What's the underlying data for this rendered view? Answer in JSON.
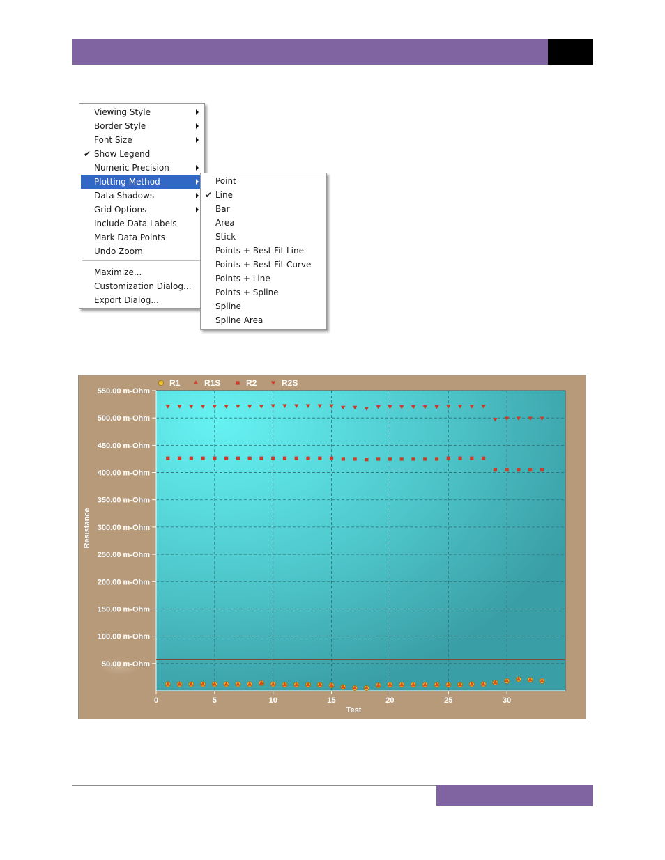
{
  "menu": {
    "items": [
      {
        "label": "Viewing Style",
        "submenu": true,
        "checked": false
      },
      {
        "label": "Border Style",
        "submenu": true,
        "checked": false
      },
      {
        "label": "Font Size",
        "submenu": true,
        "checked": false
      },
      {
        "label": "Show Legend",
        "submenu": false,
        "checked": true
      },
      {
        "label": "Numeric Precision",
        "submenu": true,
        "checked": false
      },
      {
        "label": "Plotting Method",
        "submenu": true,
        "checked": false,
        "highlighted": true
      },
      {
        "label": "Data Shadows",
        "submenu": true,
        "checked": false
      },
      {
        "label": "Grid Options",
        "submenu": true,
        "checked": false
      },
      {
        "label": "Include Data Labels",
        "submenu": false,
        "checked": false
      },
      {
        "label": "Mark Data Points",
        "submenu": false,
        "checked": false
      },
      {
        "label": "Undo Zoom",
        "submenu": false,
        "checked": false
      }
    ],
    "items2": [
      {
        "label": "Maximize..."
      },
      {
        "label": "Customization Dialog..."
      },
      {
        "label": "Export Dialog..."
      }
    ],
    "submenu": [
      {
        "label": "Point",
        "checked": false
      },
      {
        "label": "Line",
        "checked": true
      },
      {
        "label": "Bar",
        "checked": false
      },
      {
        "label": "Area",
        "checked": false
      },
      {
        "label": "Stick",
        "checked": false
      },
      {
        "label": "Points + Best Fit Line",
        "checked": false
      },
      {
        "label": "Points + Best Fit Curve",
        "checked": false
      },
      {
        "label": "Points + Line",
        "checked": false
      },
      {
        "label": "Points + Spline",
        "checked": false
      },
      {
        "label": "Spline",
        "checked": false
      },
      {
        "label": "Spline Area",
        "checked": false
      }
    ]
  },
  "chart_data": {
    "type": "scatter",
    "xlabel": "Test",
    "ylabel": "Resistance",
    "xlim": [
      0,
      35
    ],
    "ylim": [
      0,
      550
    ],
    "x_ticks": [
      "0",
      "5",
      "10",
      "15",
      "20",
      "25",
      "30"
    ],
    "x_tick_values": [
      0,
      5,
      10,
      15,
      20,
      25,
      30
    ],
    "y_ticks": [
      "50.00 m-Ohm",
      "100.00 m-Ohm",
      "150.00 m-Ohm",
      "200.00 m-Ohm",
      "250.00 m-Ohm",
      "300.00 m-Ohm",
      "350.00 m-Ohm",
      "400.00 m-Ohm",
      "450.00 m-Ohm",
      "500.00 m-Ohm",
      "550.00 m-Ohm"
    ],
    "y_tick_values": [
      50,
      100,
      150,
      200,
      250,
      300,
      350,
      400,
      450,
      500,
      550
    ],
    "grid": true,
    "legend_position": "top",
    "reference_line": 57,
    "colors": {
      "R1": "#e0b020",
      "R1S": "#cc3a2a",
      "R2": "#cc3a2a",
      "R2S": "#cc3a2a"
    },
    "x": [
      1,
      2,
      3,
      4,
      5,
      6,
      7,
      8,
      9,
      10,
      11,
      12,
      13,
      14,
      15,
      16,
      17,
      18,
      19,
      20,
      21,
      22,
      23,
      24,
      25,
      26,
      27,
      28,
      29,
      30,
      31,
      32,
      33
    ],
    "series": [
      {
        "name": "R1",
        "marker": "circle",
        "values": [
          12,
          12,
          12,
          12,
          12,
          12,
          12,
          12,
          14,
          12,
          11,
          11,
          11,
          11,
          10,
          7,
          5,
          5,
          10,
          11,
          11,
          11,
          11,
          11,
          11,
          11,
          12,
          12,
          15,
          18,
          21,
          20,
          18
        ]
      },
      {
        "name": "R1S",
        "marker": "triangle-up",
        "values": [
          12,
          12,
          12,
          12,
          12,
          12,
          12,
          12,
          14,
          12,
          11,
          11,
          11,
          11,
          10,
          7,
          5,
          5,
          10,
          11,
          11,
          11,
          11,
          11,
          11,
          11,
          12,
          12,
          15,
          18,
          21,
          20,
          18
        ]
      },
      {
        "name": "R2",
        "marker": "square",
        "values": [
          426,
          426,
          426,
          426,
          426,
          426,
          426,
          426,
          426,
          426,
          426,
          426,
          426,
          426,
          426,
          425,
          425,
          424,
          425,
          425,
          425,
          425,
          425,
          425,
          426,
          426,
          426,
          426,
          405,
          405,
          405,
          405,
          405
        ]
      },
      {
        "name": "R2S",
        "marker": "triangle-down",
        "values": [
          521,
          521,
          521,
          521,
          521,
          521,
          521,
          521,
          521,
          522,
          522,
          522,
          522,
          522,
          522,
          519,
          519,
          517,
          520,
          520,
          520,
          520,
          520,
          520,
          521,
          521,
          521,
          521,
          497,
          499,
          499,
          499,
          499
        ]
      }
    ]
  }
}
